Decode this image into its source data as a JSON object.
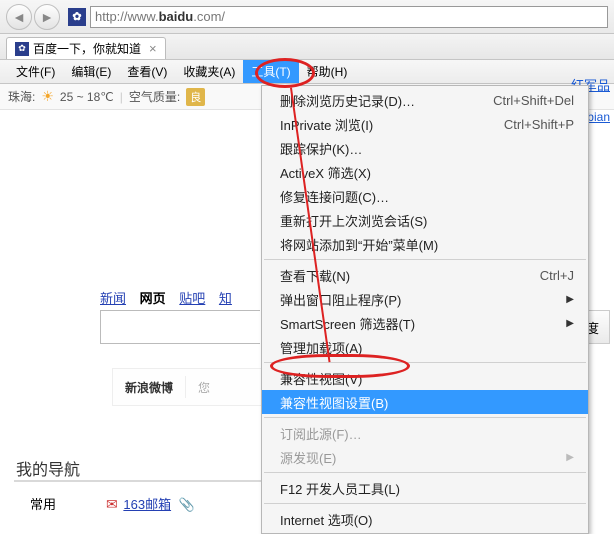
{
  "address": {
    "prefix": "http://www.",
    "host": "baidu",
    "suffix": ".com/"
  },
  "tab": {
    "title": "百度一下，你就知道"
  },
  "menubar": {
    "file": "文件(F)",
    "edit": "编辑(E)",
    "view": "查看(V)",
    "favorites": "收藏夹(A)",
    "tools": "工具(T)",
    "help": "帮助(H)"
  },
  "weather": {
    "city": "珠海:",
    "temp": "25 ~ 18℃",
    "aqi_label": "空气质量:",
    "aqi_value": "良"
  },
  "right_link": "edubian",
  "baidu_tabs": {
    "news": "新闻",
    "web": "网页",
    "tieba": "贴吧",
    "know": "知"
  },
  "search_button": "百度",
  "mid_tabs": {
    "weibo": "新浪微博",
    "you": "您"
  },
  "section_title": "我的导航",
  "bottom": {
    "common": "常用",
    "mail163": "163邮箱"
  },
  "bottom_right_link": "红军品",
  "tools_menu": {
    "delete_history": {
      "label": "删除浏览历史记录(D)…",
      "shortcut": "Ctrl+Shift+Del"
    },
    "inprivate": {
      "label": "InPrivate 浏览(I)",
      "shortcut": "Ctrl+Shift+P"
    },
    "tracking": {
      "label": "跟踪保护(K)…"
    },
    "activex": {
      "label": "ActiveX 筛选(X)"
    },
    "fix_conn": {
      "label": "修复连接问题(C)…"
    },
    "reopen": {
      "label": "重新打开上次浏览会话(S)"
    },
    "add_start": {
      "label": "将网站添加到“开始”菜单(M)"
    },
    "downloads": {
      "label": "查看下载(N)",
      "shortcut": "Ctrl+J"
    },
    "popup": {
      "label": "弹出窗口阻止程序(P)"
    },
    "smartscreen": {
      "label": "SmartScreen 筛选器(T)"
    },
    "addons": {
      "label": "管理加载项(A)"
    },
    "compat_view": {
      "label": "兼容性视图(V)"
    },
    "compat_settings": {
      "label": "兼容性视图设置(B)"
    },
    "subscribe": {
      "label": "订阅此源(F)…"
    },
    "feed_discover": {
      "label": "源发现(E)"
    },
    "devtools": {
      "label": "F12 开发人员工具(L)"
    },
    "inet_options": {
      "label": "Internet 选项(O)"
    }
  }
}
